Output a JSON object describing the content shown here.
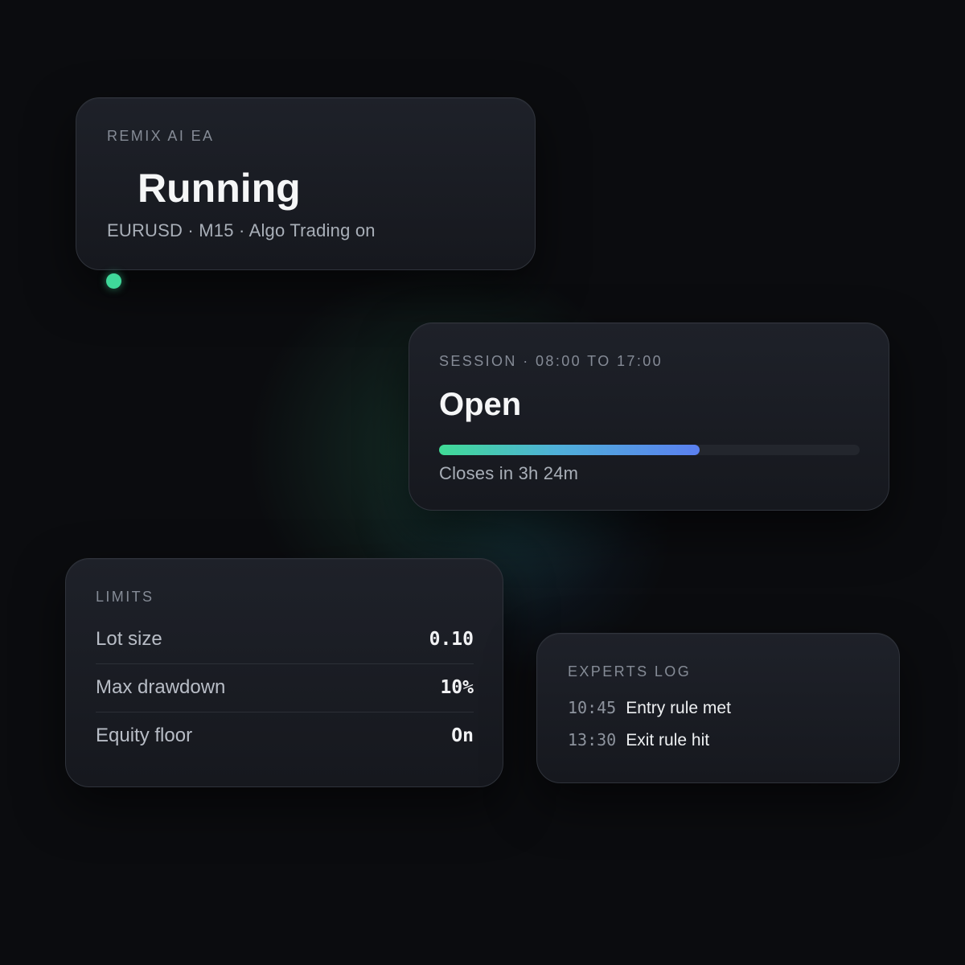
{
  "status_card": {
    "eyebrow": "REMIX AI EA",
    "state": "Running",
    "details": "EURUSD · M15 · Algo Trading on",
    "indicator_color": "#3fd99a"
  },
  "session_card": {
    "eyebrow": "SESSION · 08:00 TO 17:00",
    "state": "Open",
    "progress": 0.62,
    "closes_text": "Closes in 3h 24m",
    "progress_colors": [
      "#40db96",
      "#5a7ff0"
    ]
  },
  "limits_card": {
    "eyebrow": "LIMITS",
    "rows": [
      {
        "label": "Lot size",
        "value": "0.10"
      },
      {
        "label": "Max drawdown",
        "value": "10%"
      },
      {
        "label": "Equity floor",
        "value": "On"
      }
    ]
  },
  "log_card": {
    "eyebrow": "EXPERTS LOG",
    "entries": [
      {
        "time": "10:45",
        "message": "Entry rule met"
      },
      {
        "time": "13:30",
        "message": "Exit rule hit"
      }
    ]
  }
}
